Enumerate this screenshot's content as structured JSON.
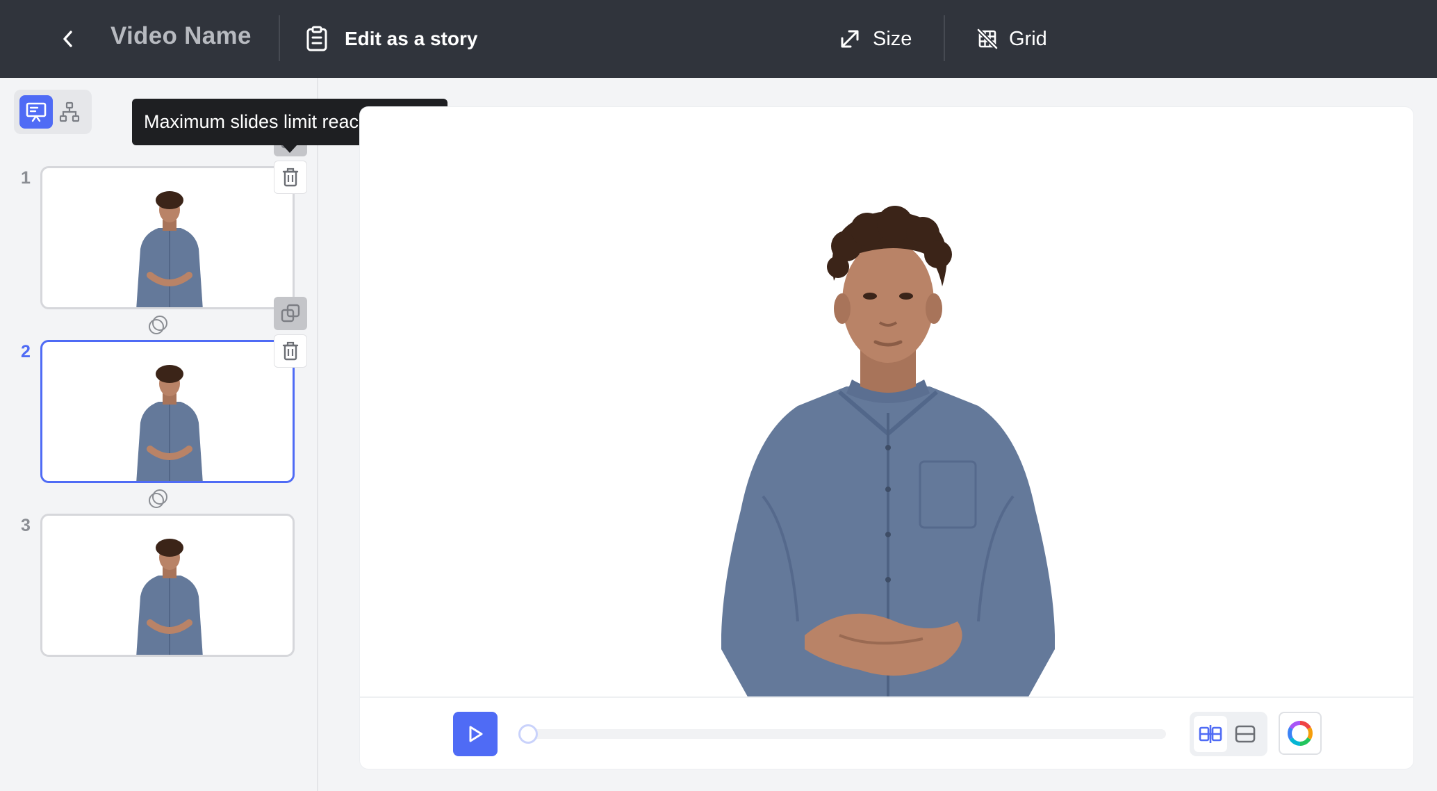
{
  "header": {
    "video_name": "Video Name",
    "edit_story_label": "Edit as a story",
    "size_label": "Size",
    "grid_label": "Grid"
  },
  "tooltip": {
    "text": "Maximum slides limit reached"
  },
  "sidebar": {
    "slides": [
      {
        "number": "1",
        "active": false
      },
      {
        "number": "2",
        "active": true
      },
      {
        "number": "3",
        "active": false
      }
    ]
  },
  "icons": {
    "back": "chevron-left-icon",
    "story": "clipboard-icon",
    "size": "expand-diagonal-icon",
    "grid": "grid-off-icon",
    "slides_view": "presentation-icon",
    "tree_view": "hierarchy-icon",
    "duplicate": "copy-icon",
    "delete": "trash-icon",
    "transition": "transition-circles-icon",
    "play": "play-icon",
    "layout_split": "split-layout-icon",
    "layout_stack": "stack-layout-icon",
    "color": "color-wheel-icon"
  },
  "player": {
    "progress": 0
  },
  "colors": {
    "topbar": "#30343c",
    "accent": "#4f6bf5",
    "shirt": "#64799a",
    "skin": "#b98367",
    "hair": "#3b2418"
  }
}
